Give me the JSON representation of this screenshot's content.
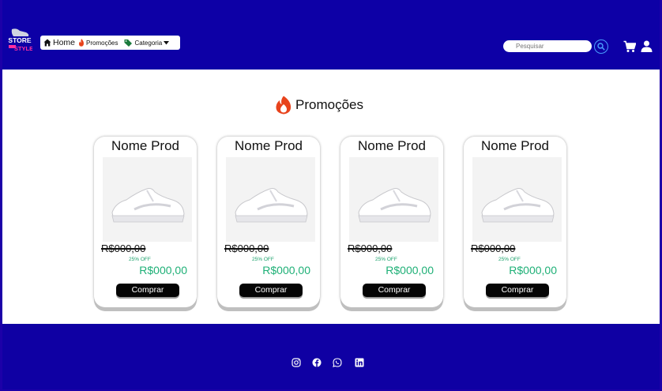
{
  "header": {
    "logo_text_top": "STORE",
    "logo_text_bottom": "STYLE",
    "nav": [
      {
        "label": "Home",
        "icon": "home-icon"
      },
      {
        "label": "Promoções",
        "icon": "fire-icon"
      },
      {
        "label": "Categoria",
        "icon": "tag-icon"
      }
    ],
    "search_placeholder": "Pesquisar",
    "icons": [
      "search-icon",
      "cart-icon",
      "user-icon"
    ]
  },
  "main": {
    "section_title": "Promoções",
    "section_icon": "fire-icon",
    "products": [
      {
        "name": "Nome Prod",
        "old_price": "R$000,00",
        "discount": "25% OFF",
        "price": "R$000,00",
        "button": "Comprar"
      },
      {
        "name": "Nome Prod",
        "old_price": "R$000,00",
        "discount": "25% OFF",
        "price": "R$000,00",
        "button": "Comprar"
      },
      {
        "name": "Nome Prod",
        "old_price": "R$000,00",
        "discount": "25% OFF",
        "price": "R$000,00",
        "button": "Comprar"
      },
      {
        "name": "Nome Prod",
        "old_price": "R$000,00",
        "discount": "25% OFF",
        "price": "R$000,00",
        "button": "Comprar"
      }
    ]
  },
  "footer": {
    "social_icons": [
      "instagram-icon",
      "facebook-icon",
      "whatsapp-icon",
      "linkedin-icon"
    ]
  },
  "colors": {
    "primary": "#0d00a6",
    "price_green": "#1fb077",
    "fire": "#e8431c",
    "tag_green": "#1a7a3c"
  }
}
